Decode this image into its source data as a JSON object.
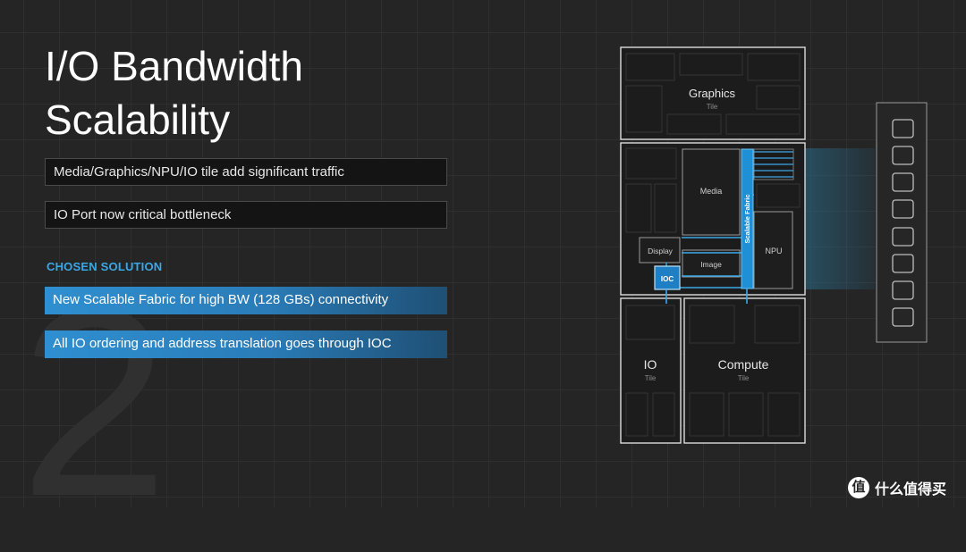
{
  "slide": {
    "number": "2",
    "title_line1": "I/O Bandwidth",
    "title_line2": "Scalability"
  },
  "problems": [
    "Media/Graphics/NPU/IO tile add significant traffic",
    "IO Port now critical bottleneck"
  ],
  "solution_heading": "CHOSEN SOLUTION",
  "solutions": [
    "New Scalable Fabric for high BW (128 GBs) connectivity",
    "All IO ordering and address translation goes through IOC"
  ],
  "diagram": {
    "graphics_tile": {
      "name": "Graphics",
      "sub": "Tile"
    },
    "media": "Media",
    "scalable_fabric": "Scalable Fabric",
    "npu": "NPU",
    "display": "Display",
    "image": "Image",
    "ioc": "IOC",
    "io_tile": {
      "name": "IO",
      "sub": "Tile"
    },
    "compute_tile": {
      "name": "Compute",
      "sub": "Tile"
    }
  },
  "watermark": {
    "icon": "值",
    "text": "什么值得买"
  },
  "colors": {
    "accent_blue": "#39a8e8",
    "fabric_blue": "#1f8fd6",
    "ioc_blue": "#1e7fc4",
    "background": "#252525"
  }
}
